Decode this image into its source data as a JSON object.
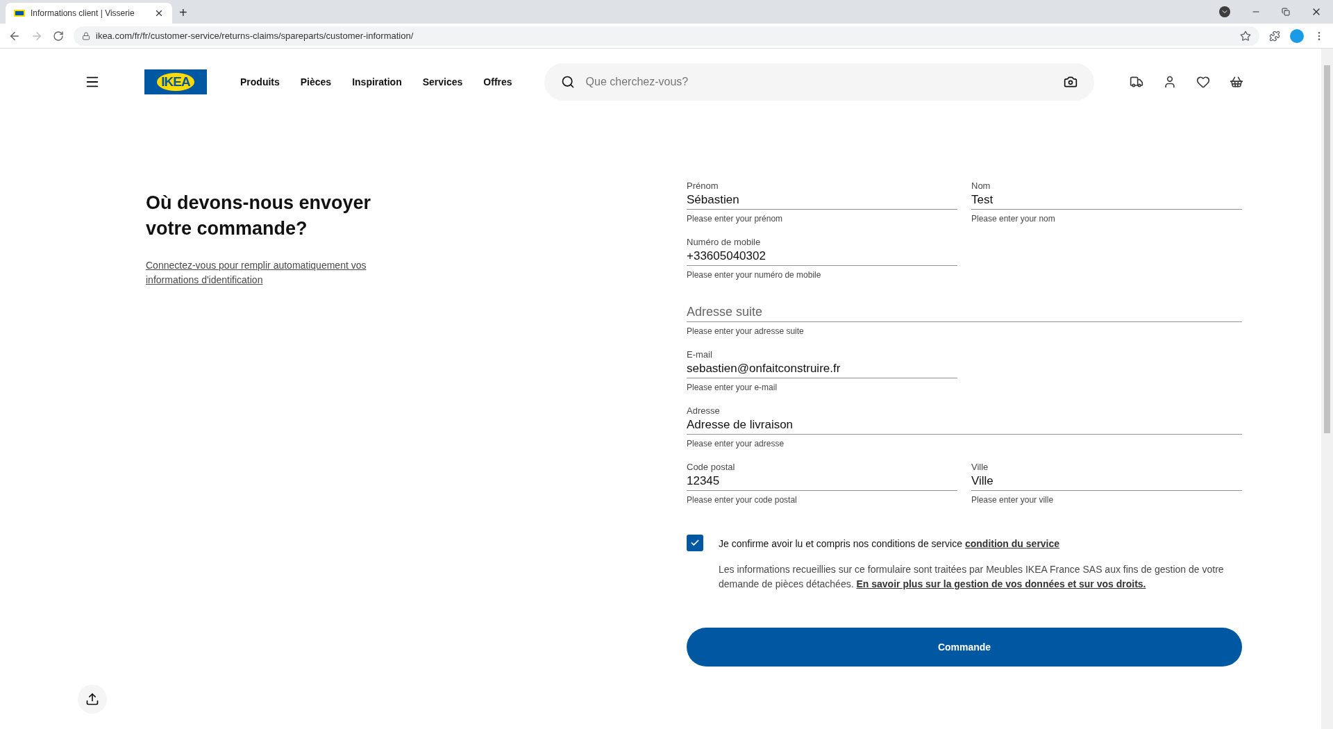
{
  "browser": {
    "tab_title": "Informations client | Visserie",
    "new_tab": "+",
    "url": "ikea.com/fr/fr/customer-service/returns-claims/spareparts/customer-information/"
  },
  "header": {
    "logo": "IKEA",
    "nav": [
      "Produits",
      "Pièces",
      "Inspiration",
      "Services",
      "Offres"
    ],
    "search": {
      "placeholder": "Que cherchez-vous?"
    }
  },
  "heading": "Où devons-nous envoyer votre commande?",
  "login_link": "Connectez-vous pour remplir automatiquement vos informations d'identification",
  "form": {
    "rows": [
      [
        {
          "label": "Prénom",
          "value": "Sébastien",
          "helper": "Please enter your prénom"
        },
        {
          "label": "Nom",
          "value": "Test",
          "helper": "Please enter your nom"
        }
      ],
      [
        {
          "label": "Numéro de mobile",
          "value": "+33605040302",
          "helper": "Please enter your numéro de mobile"
        }
      ],
      [
        {
          "placeholder": "Adresse suite",
          "helper": "Please enter your adresse suite",
          "full_width": true
        }
      ],
      [
        {
          "label": "E-mail",
          "value": "sebastien@onfaitconstruire.fr",
          "helper": "Please enter your e-mail"
        }
      ],
      [
        {
          "label": "Adresse",
          "value": "Adresse de livraison",
          "helper": "Please enter your adresse",
          "full_width": true
        }
      ],
      [
        {
          "label": "Code postal",
          "value": "12345",
          "helper": "Please enter your code postal"
        },
        {
          "label": "Ville",
          "value": "Ville",
          "helper": "Please enter your ville"
        }
      ]
    ],
    "consent": {
      "checked": true,
      "text": "Je confirme avoir lu et compris nos conditions de service",
      "link": "condition du service"
    },
    "privacy": {
      "text": "Les informations recueillies sur ce formulaire sont traitées par Meubles IKEA France SAS aux fins de gestion de votre demande de pièces détachées.",
      "link": "En savoir plus sur la gestion de vos données et sur vos droits."
    },
    "submit": "Commande"
  }
}
